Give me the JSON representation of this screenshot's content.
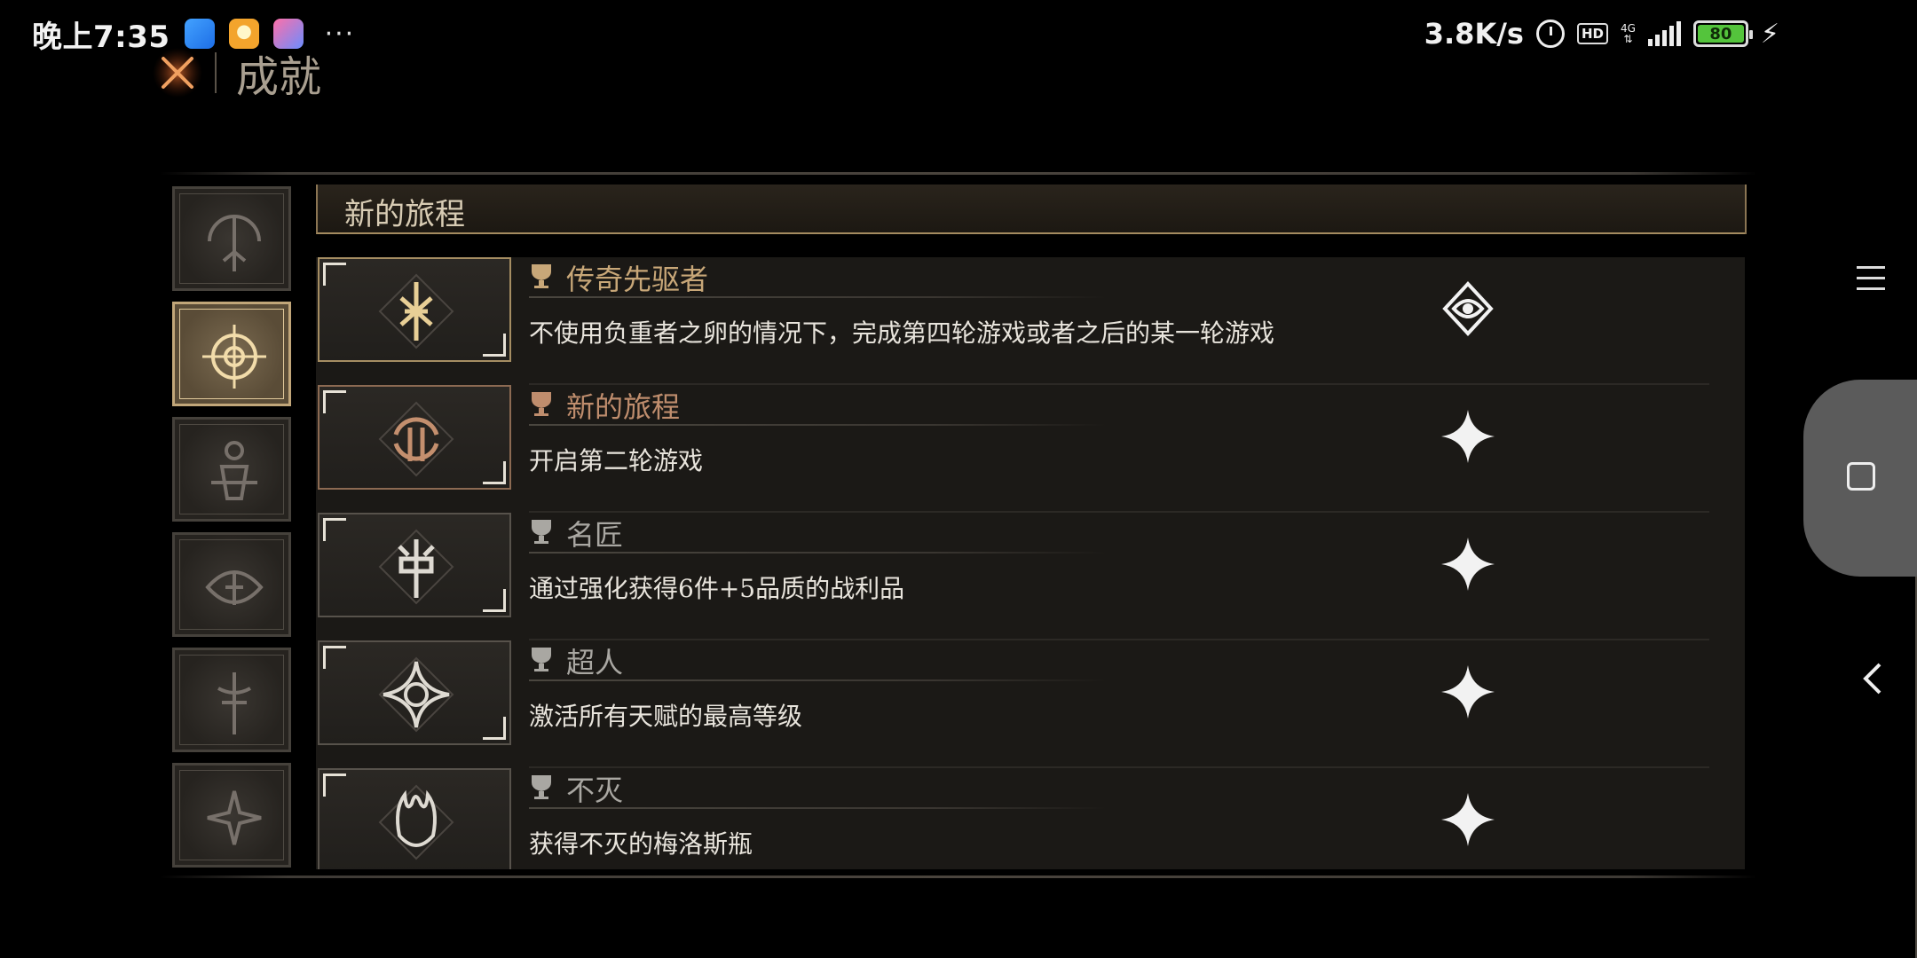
{
  "status_bar": {
    "time": "晚上7:35",
    "more": "···",
    "network_speed": "3.8K/s",
    "hd_badge": "HD",
    "network_type": "4G",
    "battery": "80"
  },
  "header": {
    "title": "成就"
  },
  "section": {
    "title": "新的旅程"
  },
  "categories": [
    {
      "icon": "scythe-icon",
      "active": false
    },
    {
      "icon": "compass-sigil-icon",
      "active": true
    },
    {
      "icon": "ankh-totem-icon",
      "active": false
    },
    {
      "icon": "eye-sigil-icon",
      "active": false
    },
    {
      "icon": "sword-sigil-icon",
      "active": false
    },
    {
      "icon": "star-sigil-icon",
      "active": false
    }
  ],
  "achievements": [
    {
      "name": "传奇先驱者",
      "description": "不使用负重者之卵的情况下，完成第四轮游戏或者之后的某一轮游戏",
      "tier": "gold",
      "status": "unlocked",
      "icon": "rune-sigil-icon"
    },
    {
      "name": "新的旅程",
      "description": "开启第二轮游戏",
      "tier": "copper",
      "status": "locked",
      "icon": "cycle-sigil-icon"
    },
    {
      "name": "名匠",
      "description": "通过强化获得6件+5品质的战利品",
      "tier": "silver",
      "status": "locked",
      "icon": "hammer-sigil-icon"
    },
    {
      "name": "超人",
      "description": "激活所有天赋的最高等级",
      "tier": "silver",
      "status": "locked",
      "icon": "star-crest-icon"
    },
    {
      "name": "不灭",
      "description": "获得不灭的梅洛斯瓶",
      "tier": "silver",
      "status": "locked",
      "icon": "flame-hand-icon"
    }
  ],
  "colors": {
    "gold": "#c8a778",
    "copper": "#bf8d6d",
    "silver": "#a9a7a2",
    "battery": "#54c43c"
  }
}
